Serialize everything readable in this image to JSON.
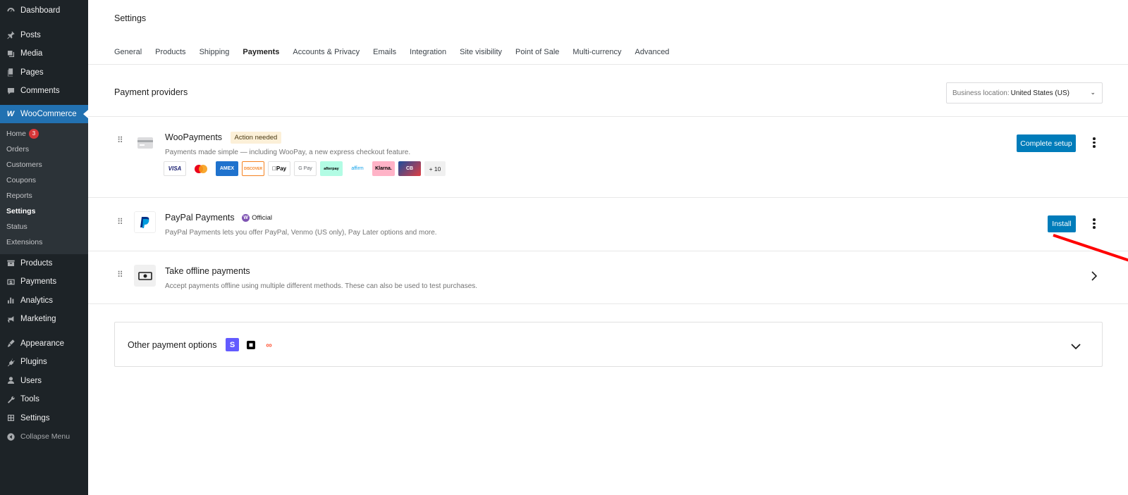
{
  "sidebar": {
    "items": [
      {
        "label": "Dashboard",
        "icon": "dashboard-icon"
      },
      {
        "label": "Posts",
        "icon": "pin-icon"
      },
      {
        "label": "Media",
        "icon": "media-icon"
      },
      {
        "label": "Pages",
        "icon": "pages-icon"
      },
      {
        "label": "Comments",
        "icon": "comment-icon"
      }
    ],
    "woocommerce": {
      "label": "WooCommerce",
      "icon_text": "W"
    },
    "sub_items": [
      {
        "label": "Home",
        "badge": "3"
      },
      {
        "label": "Orders"
      },
      {
        "label": "Customers"
      },
      {
        "label": "Coupons"
      },
      {
        "label": "Reports"
      },
      {
        "label": "Settings"
      },
      {
        "label": "Status"
      },
      {
        "label": "Extensions"
      }
    ],
    "items2": [
      {
        "label": "Products",
        "icon": "archive-icon"
      },
      {
        "label": "Payments",
        "icon": "dollar-icon"
      },
      {
        "label": "Analytics",
        "icon": "chart-icon"
      },
      {
        "label": "Marketing",
        "icon": "megaphone-icon"
      }
    ],
    "items3": [
      {
        "label": "Appearance",
        "icon": "brush-icon"
      },
      {
        "label": "Plugins",
        "icon": "plug-icon"
      },
      {
        "label": "Users",
        "icon": "user-icon"
      },
      {
        "label": "Tools",
        "icon": "wrench-icon"
      },
      {
        "label": "Settings",
        "icon": "settings-icon"
      }
    ],
    "collapse": "Collapse Menu"
  },
  "header": {
    "title": "Settings"
  },
  "tabs": [
    "General",
    "Products",
    "Shipping",
    "Payments",
    "Accounts & Privacy",
    "Emails",
    "Integration",
    "Site visibility",
    "Point of Sale",
    "Multi-currency",
    "Advanced"
  ],
  "active_tab": "Payments",
  "providers": {
    "title": "Payment providers",
    "location_label": "Business location:",
    "location_value": "United States (US)"
  },
  "woopayments": {
    "name": "WooPayments",
    "badge": "Action needed",
    "desc": "Payments made simple — including WooPay, a new express checkout feature.",
    "button": "Complete setup",
    "logos": [
      "VISA",
      "MC",
      "AMEX",
      "DISCOVER",
      "Pay",
      "G Pay",
      "afterpay",
      "affirm",
      "Klarna.",
      "CB"
    ],
    "more": "+ 10"
  },
  "paypal": {
    "name": "PayPal Payments",
    "badge": "Official",
    "desc": "PayPal Payments lets you offer PayPal, Venmo (US only), Pay Later options and more.",
    "button": "Install"
  },
  "offline": {
    "name": "Take offline payments",
    "desc": "Accept payments offline using multiple different methods. These can also be used to test purchases."
  },
  "other": {
    "title": "Other payment options",
    "logos": [
      "S",
      "■",
      "∞"
    ]
  },
  "colors": {
    "accent": "#007cba",
    "tab_underline": "#3858e9",
    "sidebar": "#1d2327",
    "annotation_arrow": "#ff0000"
  }
}
